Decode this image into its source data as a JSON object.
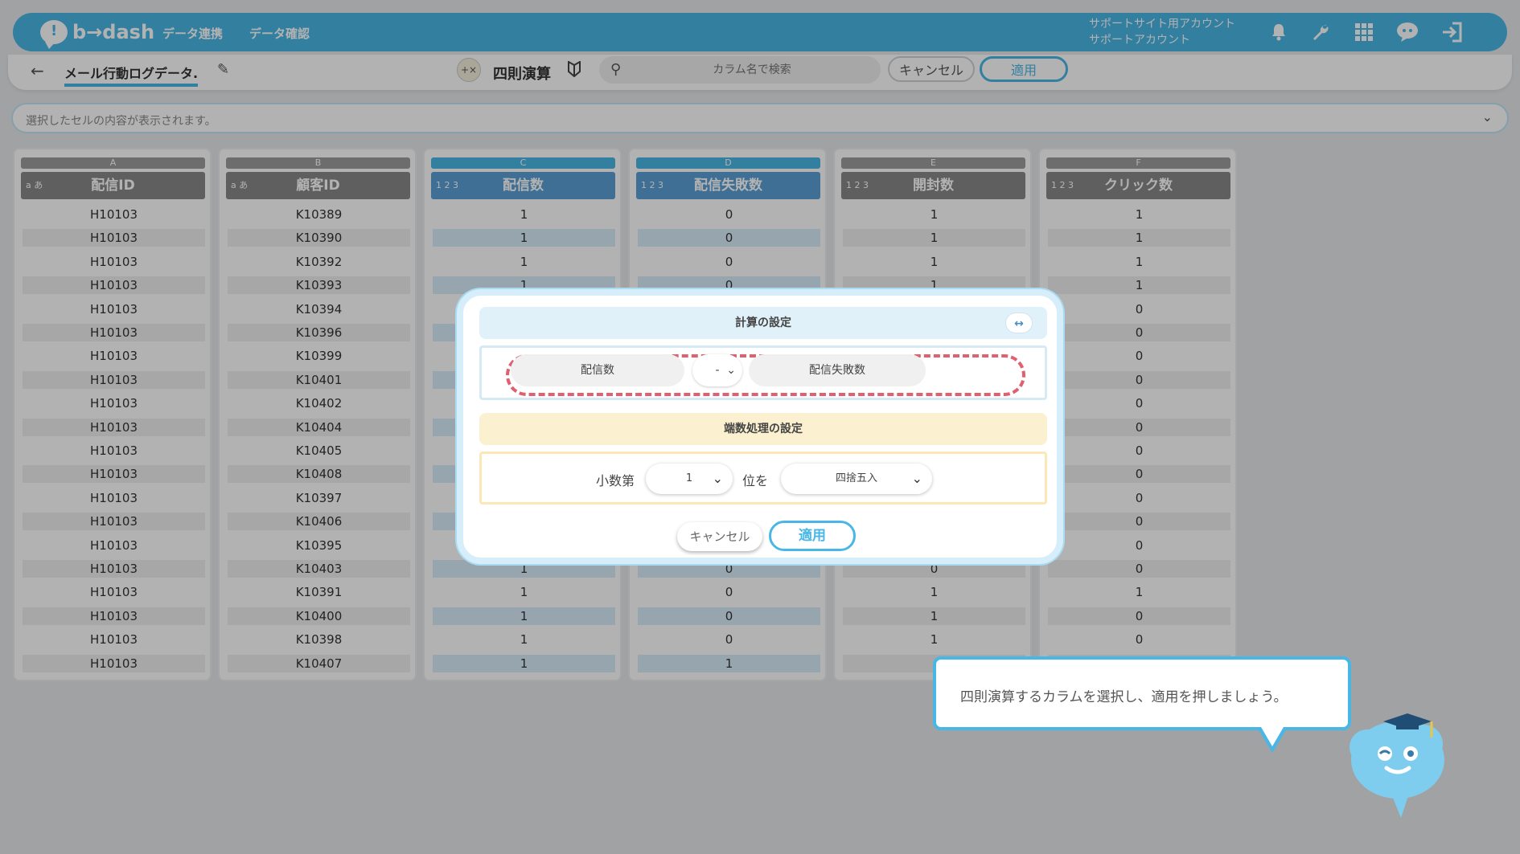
{
  "header": {
    "logo_text": "b→dash",
    "nav": [
      "データ連携",
      "データ確認"
    ],
    "account_line1": "サポートサイト用アカウント",
    "account_line2": "サポートアカウント",
    "icons": [
      "bell-icon",
      "wrench-icon",
      "apps-grid-icon",
      "brain-chat-icon",
      "logout-icon"
    ],
    "accent_color": "#49b7e6"
  },
  "toolbar": {
    "back_icon": "arrow-left-icon",
    "dataset_name": "メール行動ログデータ.",
    "edit_icon": "pencil-icon",
    "operation_label": "四則演算",
    "search_placeholder": "カラム名で検索",
    "cancel_label": "キャンセル",
    "apply_label": "適用"
  },
  "cell_display": {
    "text": "選択したセルの内容が表示されます。"
  },
  "table": {
    "columns": [
      {
        "letter": "A",
        "type": "a あ",
        "name": "配信ID",
        "selected": false
      },
      {
        "letter": "B",
        "type": "a あ",
        "name": "顧客ID",
        "selected": false
      },
      {
        "letter": "C",
        "type": "1 2 3",
        "name": "配信数",
        "selected": true
      },
      {
        "letter": "D",
        "type": "1 2 3",
        "name": "配信失敗数",
        "selected": true
      },
      {
        "letter": "E",
        "type": "1 2 3",
        "name": "開封数",
        "selected": false
      },
      {
        "letter": "F",
        "type": "1 2 3",
        "name": "クリック数",
        "selected": false
      }
    ],
    "rows": [
      [
        "H10103",
        "K10389",
        "1",
        "0",
        "1",
        "1"
      ],
      [
        "H10103",
        "K10390",
        "1",
        "0",
        "1",
        "1"
      ],
      [
        "H10103",
        "K10392",
        "1",
        "0",
        "1",
        "1"
      ],
      [
        "H10103",
        "K10393",
        "1",
        "0",
        "1",
        "1"
      ],
      [
        "H10103",
        "K10394",
        "",
        "",
        "",
        "0"
      ],
      [
        "H10103",
        "K10396",
        "",
        "",
        "",
        "0"
      ],
      [
        "H10103",
        "K10399",
        "",
        "",
        "",
        "0"
      ],
      [
        "H10103",
        "K10401",
        "",
        "",
        "",
        "0"
      ],
      [
        "H10103",
        "K10402",
        "",
        "",
        "",
        "0"
      ],
      [
        "H10103",
        "K10404",
        "",
        "",
        "",
        "0"
      ],
      [
        "H10103",
        "K10405",
        "",
        "",
        "",
        "0"
      ],
      [
        "H10103",
        "K10408",
        "",
        "",
        "",
        "0"
      ],
      [
        "H10103",
        "K10397",
        "",
        "",
        "",
        "0"
      ],
      [
        "H10103",
        "K10406",
        "",
        "",
        "",
        "0"
      ],
      [
        "H10103",
        "K10395",
        "",
        "",
        "",
        "0"
      ],
      [
        "H10103",
        "K10403",
        "1",
        "0",
        "0",
        "0"
      ],
      [
        "H10103",
        "K10391",
        "1",
        "0",
        "1",
        "1"
      ],
      [
        "H10103",
        "K10400",
        "1",
        "0",
        "1",
        "0"
      ],
      [
        "H10103",
        "K10398",
        "1",
        "0",
        "1",
        "0"
      ],
      [
        "H10103",
        "K10407",
        "1",
        "1",
        "",
        ""
      ]
    ]
  },
  "modal": {
    "calc_title": "計算の設定",
    "swap_icon": "↔",
    "left_operand": "配信数",
    "operator": "-",
    "right_operand": "配信失敗数",
    "rounding_title": "端数処理の設定",
    "decimal_prefix": "小数第",
    "decimal_place": "1",
    "decimal_suffix": "位を",
    "rounding_method": "四捨五入",
    "cancel_label": "キャンセル",
    "apply_label": "適用"
  },
  "tooltip": {
    "text": "四則演算するカラムを選択し、適用を押しましょう。"
  },
  "mascot_icon": "brain-mascot-icon"
}
